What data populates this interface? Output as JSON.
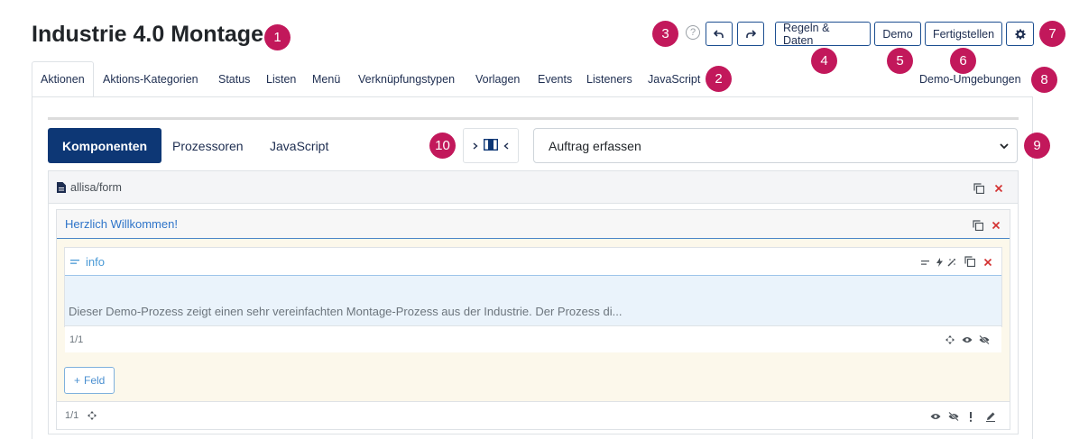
{
  "page": {
    "title": "Industrie 4.0 Montage"
  },
  "toolbar": {
    "help": "?",
    "rules_label": "Regeln & Daten",
    "demo_label": "Demo",
    "finish_label": "Fertigstellen"
  },
  "badges": {
    "b1": "1",
    "b2": "2",
    "b3": "3",
    "b4": "4",
    "b5": "5",
    "b6": "6",
    "b7": "7",
    "b8": "8",
    "b9": "9",
    "b10": "10"
  },
  "tabs": [
    {
      "label": "Aktionen"
    },
    {
      "label": "Aktions-Kategorien"
    },
    {
      "label": "Status"
    },
    {
      "label": "Listen"
    },
    {
      "label": "Menü"
    },
    {
      "label": "Verknüpfungstypen"
    },
    {
      "label": "Vorlagen"
    },
    {
      "label": "Events"
    },
    {
      "label": "Listeners"
    },
    {
      "label": "JavaScript"
    }
  ],
  "demo_environments": "Demo-Umgebungen",
  "subtabs": [
    {
      "label": "Komponenten"
    },
    {
      "label": "Prozessoren"
    },
    {
      "label": "JavaScript"
    }
  ],
  "action_select": {
    "selected": "Auftrag erfassen"
  },
  "form": {
    "name": "allisa/form",
    "section": {
      "title": "Herzlich Willkommen!",
      "field": {
        "name": "info",
        "text": "Dieser Demo-Prozess zeigt einen sehr vereinfachten Montage-Prozess aus der Industrie. Der Prozess di...",
        "pager": "1/1"
      },
      "add_field_label": "Feld",
      "pager": "1/1"
    }
  },
  "colors": {
    "badge": "#c2185b",
    "primary": "#0d3775",
    "field_link": "#4a9ad6",
    "danger": "#d32f2f"
  }
}
